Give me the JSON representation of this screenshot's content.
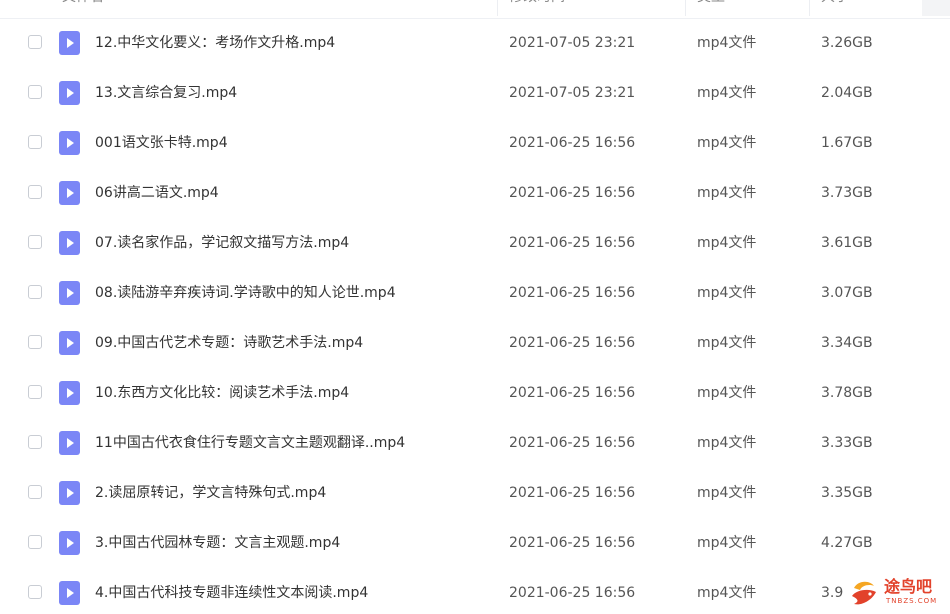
{
  "header": {
    "col_name": "文件名",
    "col_modified": "修改时间",
    "col_type": "类型",
    "col_size": "大小"
  },
  "files": [
    {
      "name": "12.中华文化要义：考场作文升格.mp4",
      "modified": "2021-07-05 23:21",
      "type": "mp4文件",
      "size": "3.26GB"
    },
    {
      "name": "13.文言综合复习.mp4",
      "modified": "2021-07-05 23:21",
      "type": "mp4文件",
      "size": "2.04GB"
    },
    {
      "name": "001语文张卡特.mp4",
      "modified": "2021-06-25 16:56",
      "type": "mp4文件",
      "size": "1.67GB"
    },
    {
      "name": "06讲高二语文.mp4",
      "modified": "2021-06-25 16:56",
      "type": "mp4文件",
      "size": "3.73GB"
    },
    {
      "name": "07.读名家作品，学记叙文描写方法.mp4",
      "modified": "2021-06-25 16:56",
      "type": "mp4文件",
      "size": "3.61GB"
    },
    {
      "name": "08.读陆游辛弃疾诗词.学诗歌中的知人论世.mp4",
      "modified": "2021-06-25 16:56",
      "type": "mp4文件",
      "size": "3.07GB"
    },
    {
      "name": "09.中国古代艺术专题：诗歌艺术手法.mp4",
      "modified": "2021-06-25 16:56",
      "type": "mp4文件",
      "size": "3.34GB"
    },
    {
      "name": "10.东西方文化比较：阅读艺术手法.mp4",
      "modified": "2021-06-25 16:56",
      "type": "mp4文件",
      "size": "3.78GB"
    },
    {
      "name": "11中国古代衣食住行专题文言文主题观翻译..mp4",
      "modified": "2021-06-25 16:56",
      "type": "mp4文件",
      "size": "3.33GB"
    },
    {
      "name": "2.读屈原转记，学文言特殊句式.mp4",
      "modified": "2021-06-25 16:56",
      "type": "mp4文件",
      "size": "3.35GB"
    },
    {
      "name": "3.中国古代园林专题：文言主观题.mp4",
      "modified": "2021-06-25 16:56",
      "type": "mp4文件",
      "size": "4.27GB"
    },
    {
      "name": "4.中国古代科技专题非连续性文本阅读.mp4",
      "modified": "2021-06-25 16:56",
      "type": "mp4文件",
      "size": "3.9"
    }
  ],
  "watermark": {
    "text": "途鸟吧",
    "sub": "TNBZS.COM",
    "color": "#e2422b"
  },
  "icons": {
    "file": "video-file-icon",
    "sort": "sort-desc-icon"
  },
  "colors": {
    "file_icon": "#7b86f6",
    "sort_accent": "#4e8af7"
  }
}
